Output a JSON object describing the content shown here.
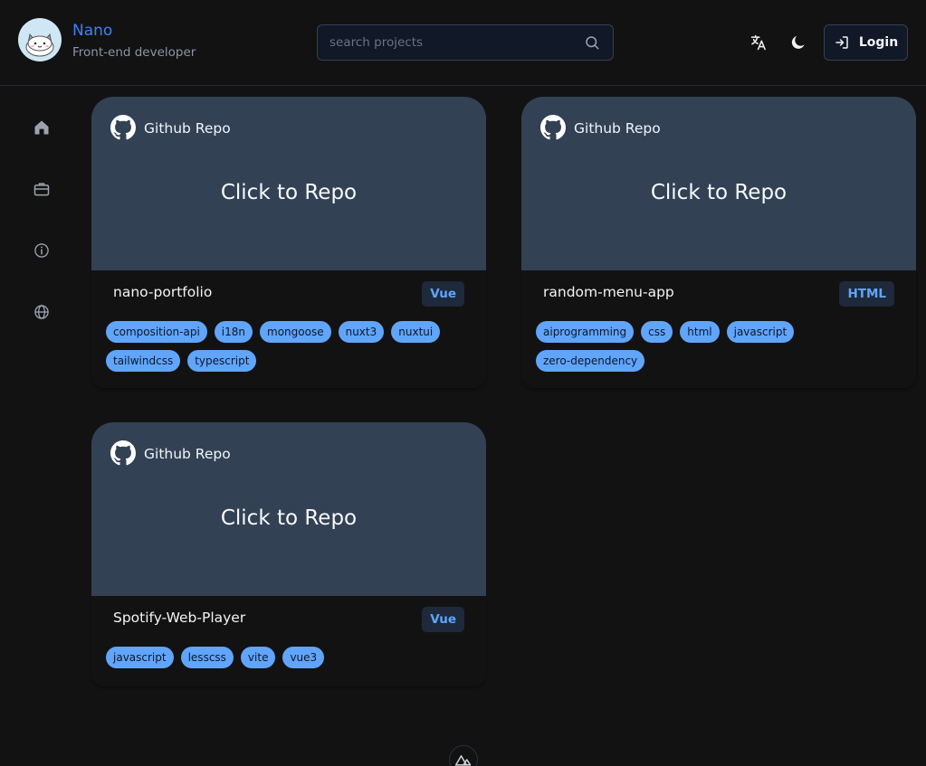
{
  "header": {
    "name": "Nano",
    "role": "Front-end developer",
    "search_placeholder": "search projects",
    "login_label": "Login"
  },
  "cards": [
    {
      "badge": "Github Repo",
      "cta": "Click to Repo",
      "title": "nano-portfolio",
      "language": "Vue",
      "tags": [
        "composition-api",
        "i18n",
        "mongoose",
        "nuxt3",
        "nuxtui",
        "tailwindcss",
        "typescript"
      ]
    },
    {
      "badge": "Github Repo",
      "cta": "Click to Repo",
      "title": "random-menu-app",
      "language": "HTML",
      "tags": [
        "aiprogramming",
        "css",
        "html",
        "javascript",
        "zero-dependency"
      ]
    },
    {
      "badge": "Github Repo",
      "cta": "Click to Repo",
      "title": "Spotify-Web-Player",
      "language": "Vue",
      "tags": [
        "javascript",
        "lesscss",
        "vite",
        "vue3"
      ]
    }
  ],
  "colors": {
    "background": "#121212",
    "card_header": "#334155",
    "accent": "#3b82f6",
    "tag": "#60a5fa"
  }
}
